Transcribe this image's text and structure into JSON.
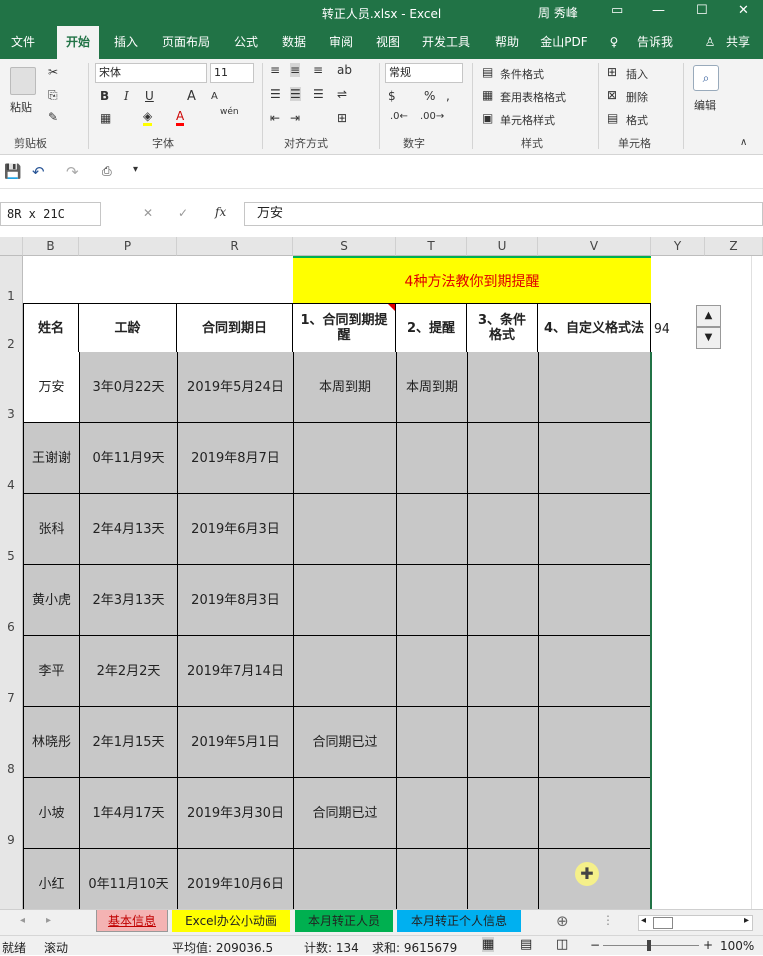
{
  "window": {
    "title": "转正人员.xlsx  -  Excel",
    "user": "周 秀峰"
  },
  "menu_tabs": [
    "文件",
    "开始",
    "插入",
    "页面布局",
    "公式",
    "数据",
    "审阅",
    "视图",
    "开发工具",
    "帮助",
    "金山PDF",
    "告诉我",
    "共享"
  ],
  "ribbon": {
    "clipboard": {
      "label": "剪贴板",
      "paste": "粘贴"
    },
    "font": {
      "label": "字体",
      "name": "宋体",
      "size": "11",
      "bold": "B",
      "italic": "I",
      "underline": "U",
      "grow": "A",
      "shrink": "A",
      "phonetic": "wén"
    },
    "align": {
      "label": "对齐方式"
    },
    "number": {
      "label": "数字",
      "format": "常规",
      "percent": "%",
      "comma": ","
    },
    "styles": {
      "label": "样式",
      "cond": "条件格式",
      "table": "套用表格格式",
      "cell": "单元格样式"
    },
    "cells": {
      "label": "单元格",
      "insert": "插入",
      "delete": "删除",
      "format": "格式"
    },
    "edit": {
      "label": "编辑"
    }
  },
  "namebox": "8R x 21C",
  "formula": "万安",
  "columns": [
    "B",
    "P",
    "R",
    "S",
    "T",
    "U",
    "V",
    "Y",
    "Z"
  ],
  "rows": [
    "1",
    "2",
    "3",
    "4",
    "5",
    "6",
    "7",
    "8",
    "9"
  ],
  "banner": "4种方法教你到期提醒",
  "headers": [
    "姓名",
    "工龄",
    "合同到期日",
    "1、合同到期提醒",
    "2、提醒",
    "3、条件格式",
    "4、自定义格式法"
  ],
  "side_value": "94",
  "table": [
    [
      "万安",
      "3年0月22天",
      "2019年5月24日",
      "本周到期",
      "本周到期",
      "",
      ""
    ],
    [
      "王谢谢",
      "0年11月9天",
      "2019年8月7日",
      "",
      "",
      "",
      ""
    ],
    [
      "张科",
      "2年4月13天",
      "2019年6月3日",
      "",
      "",
      "",
      ""
    ],
    [
      "黄小虎",
      "2年3月13天",
      "2019年8月3日",
      "",
      "",
      "",
      ""
    ],
    [
      "李平",
      "2年2月2天",
      "2019年7月14日",
      "",
      "",
      "",
      ""
    ],
    [
      "林晓彤",
      "2年1月15天",
      "2019年5月1日",
      "合同期已过",
      "",
      "",
      ""
    ],
    [
      "小坡",
      "1年4月17天",
      "2019年3月30日",
      "合同期已过",
      "",
      "",
      ""
    ],
    [
      "小红",
      "0年11月10天",
      "2019年10月6日",
      "",
      "",
      "",
      ""
    ]
  ],
  "sheets": [
    "基本信息",
    "Excel办公小动画",
    "本月转正人员",
    "本月转正个人信息"
  ],
  "sheet_colors": [
    "#f4b3b3",
    "#ffff00",
    "#00b050",
    "#00b0f0"
  ],
  "status": {
    "ready": "就绪",
    "scroll": "滚动",
    "avg": "平均值: 209036.5",
    "count": "计数: 134",
    "sum": "求和: 9615679",
    "zoom": "100%"
  },
  "colors": {
    "excel_green": "#217346",
    "banner_yellow": "#ffff00",
    "banner_text": "#e00000"
  }
}
